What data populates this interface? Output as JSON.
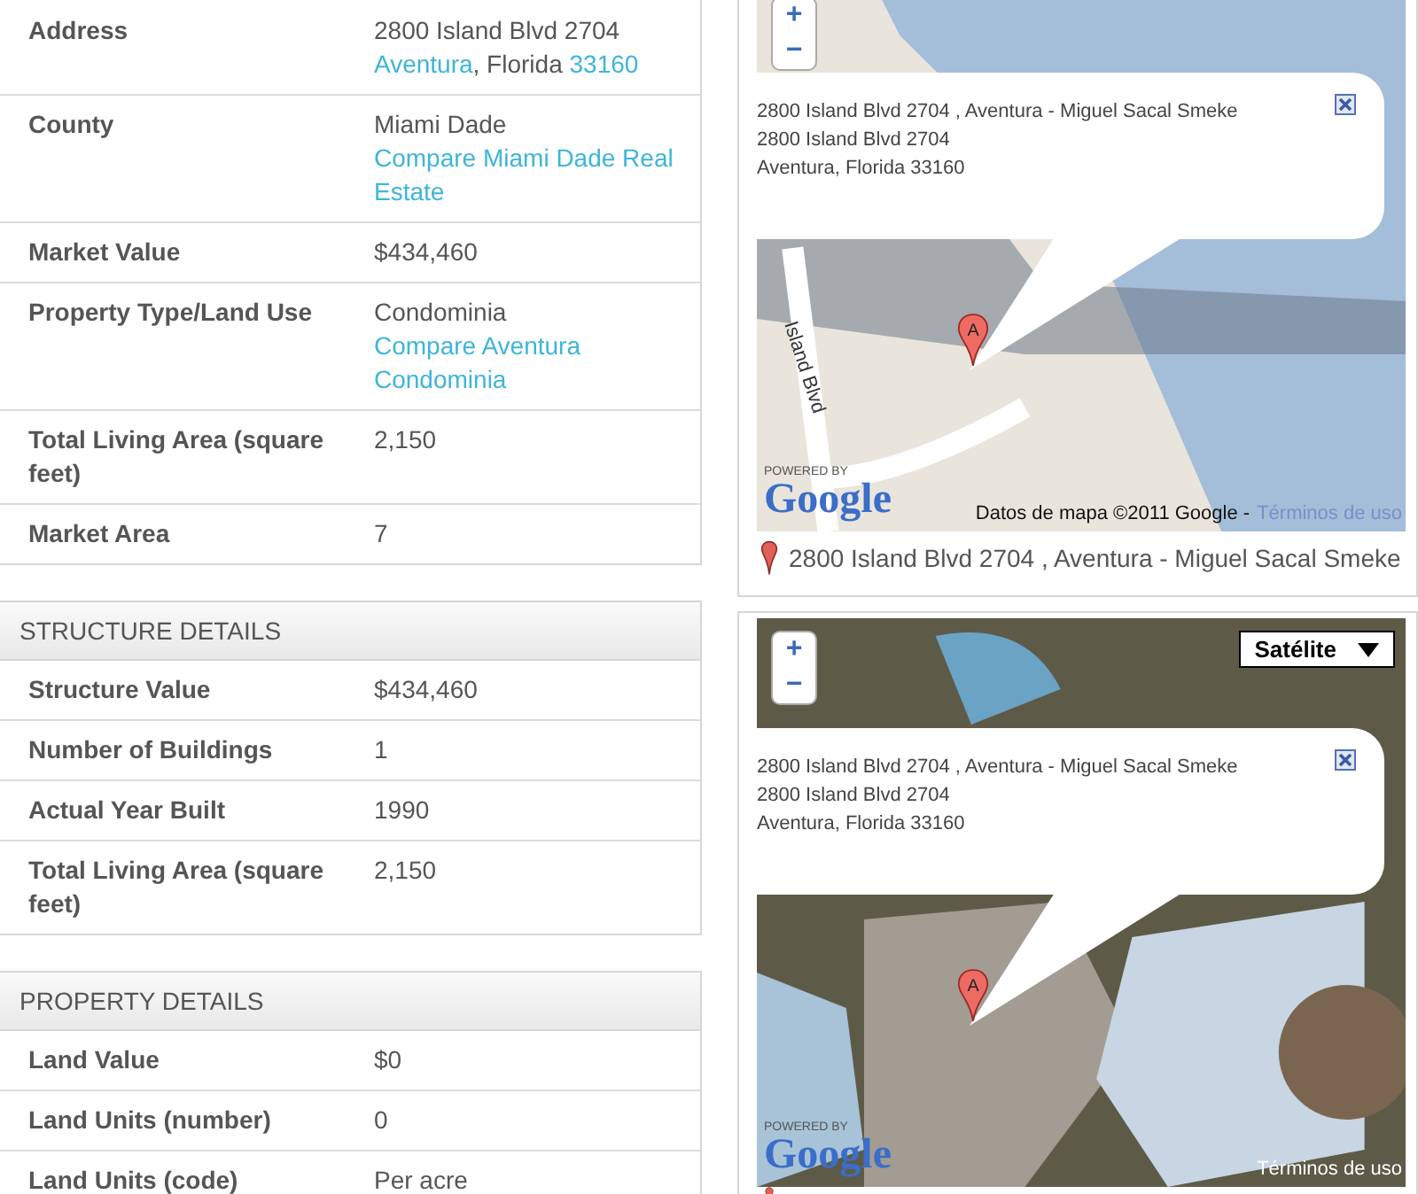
{
  "sections": [
    {
      "rows": [
        {
          "label": "Address",
          "lines": [
            [
              {
                "text": "2800 Island Blvd 2704",
                "link": false
              }
            ],
            [
              {
                "text": "Aventura",
                "link": true
              },
              {
                "text": ", Florida ",
                "link": false
              },
              {
                "text": "33160",
                "link": true
              }
            ]
          ]
        },
        {
          "label": "County",
          "lines": [
            [
              {
                "text": "Miami Dade",
                "link": false
              }
            ],
            [
              {
                "text": "Compare Miami Dade Real Estate",
                "link": true
              }
            ]
          ]
        },
        {
          "label": "Market Value",
          "lines": [
            [
              {
                "text": "$434,460",
                "link": false
              }
            ]
          ]
        },
        {
          "label": "Property Type/Land Use",
          "lines": [
            [
              {
                "text": "Condominia",
                "link": false
              }
            ],
            [
              {
                "text": "Compare Aventura Condominia",
                "link": true
              }
            ]
          ]
        },
        {
          "label": "Total Living Area (square feet)",
          "lines": [
            [
              {
                "text": "2,150",
                "link": false
              }
            ]
          ]
        },
        {
          "label": "Market Area",
          "lines": [
            [
              {
                "text": "7",
                "link": false
              }
            ]
          ]
        }
      ]
    },
    {
      "title": "STRUCTURE DETAILS",
      "rows": [
        {
          "label": "Structure Value",
          "lines": [
            [
              {
                "text": "$434,460",
                "link": false
              }
            ]
          ]
        },
        {
          "label": "Number of Buildings",
          "lines": [
            [
              {
                "text": "1",
                "link": false
              }
            ]
          ]
        },
        {
          "label": "Actual Year Built",
          "lines": [
            [
              {
                "text": "1990",
                "link": false
              }
            ]
          ]
        },
        {
          "label": "Total Living Area (square feet)",
          "lines": [
            [
              {
                "text": "2,150",
                "link": false
              }
            ]
          ]
        }
      ]
    },
    {
      "title": "PROPERTY DETAILS",
      "rows": [
        {
          "label": "Land Value",
          "lines": [
            [
              {
                "text": "$0",
                "link": false
              }
            ]
          ]
        },
        {
          "label": "Land Units (number)",
          "lines": [
            [
              {
                "text": "0",
                "link": false
              }
            ]
          ]
        },
        {
          "label": "Land Units (code)",
          "lines": [
            [
              {
                "text": "Per acre",
                "link": false
              }
            ]
          ]
        }
      ]
    }
  ],
  "maps": [
    {
      "kind": "map",
      "zoom_in": "+",
      "zoom_out": "−",
      "info_lines": [
        "2800 Island Blvd 2704 , Aventura - Miguel Sacal Smeke",
        "2800 Island Blvd 2704",
        "Aventura, Florida 33160"
      ],
      "marker_label": "A",
      "street_labels": [
        "Island Blvd"
      ],
      "powered_by": "POWERED BY",
      "logo": "Google",
      "attribution": "Datos de mapa ©2011 Google -",
      "terms_link": "Términos de uso",
      "caption": "2800 Island Blvd 2704 , Aventura - Miguel Sacal Smeke"
    },
    {
      "kind": "satellite",
      "zoom_in": "+",
      "zoom_out": "−",
      "map_type": "Satélite",
      "info_lines": [
        "2800 Island Blvd 2704 , Aventura - Miguel Sacal Smeke",
        "2800 Island Blvd 2704",
        "Aventura, Florida 33160"
      ],
      "marker_label": "A",
      "powered_by": "POWERED BY",
      "logo": "Google",
      "terms_link": "Términos de uso"
    }
  ]
}
